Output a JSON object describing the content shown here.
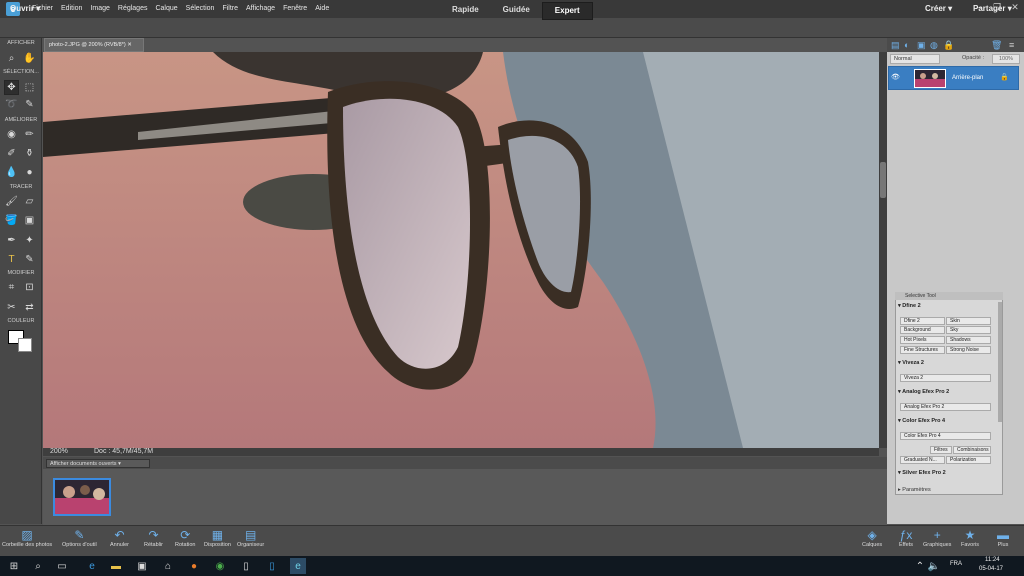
{
  "menu": {
    "items": [
      "Fichier",
      "Edition",
      "Image",
      "Réglages",
      "Calque",
      "Sélection",
      "Filtre",
      "Affichage",
      "Fenêtre",
      "Aide"
    ]
  },
  "modebar": {
    "open_label": "Ouvrir",
    "modes": [
      "Rapide",
      "Guidée",
      "Expert"
    ],
    "active_mode": "Expert",
    "create_label": "Créer",
    "share_label": "Partager"
  },
  "tools": {
    "sections": [
      "AFFICHER",
      "SÉLECTION...",
      "AMÉLIORER",
      "TRACER",
      "MODIFIER",
      "COULEUR"
    ]
  },
  "document": {
    "tab_title": "photo-2.JPG @ 200% (RVB/8*)",
    "zoom": "200%",
    "doc_info": "Doc : 45,7M/45,7M"
  },
  "photobin": {
    "select_value": "Afficher documents ouverts"
  },
  "layers": {
    "blend_mode": "Normal",
    "opacity_label": "Opacité :",
    "opacity_value": "100%",
    "layer_name": "Arrière-plan"
  },
  "selective_tool": {
    "title": "Selective Tool",
    "sections": [
      {
        "name": "Dfine 2",
        "buttons": [
          "Dfine 2",
          "Skin",
          "Background",
          "Sky",
          "Hot Pixels",
          "Shadows",
          "Fine Structures",
          "Strong Noise"
        ]
      },
      {
        "name": "Viveza 2",
        "buttons": [
          "Viveza 2"
        ]
      },
      {
        "name": "Analog Efex Pro 2",
        "buttons": [
          "Analog Efex Pro 2"
        ]
      },
      {
        "name": "Color Efex Pro 4",
        "buttons": [
          "Color Efex Pro 4",
          "Filtres",
          "Combinaisons",
          "Graduated N...",
          "Polarization"
        ]
      },
      {
        "name": "Silver Efex Pro 2",
        "buttons": []
      }
    ],
    "params_label": "Paramètres"
  },
  "bottombar": {
    "left": [
      "Corbeille des photos",
      "Options d'outil",
      "Annuler",
      "Rétablir",
      "Rotation",
      "Disposition",
      "Organiseur"
    ],
    "right": [
      "Calques",
      "Effets",
      "Graphiques",
      "Favoris",
      "Plus"
    ]
  },
  "taskbar": {
    "lang": "FRA",
    "time": "11:24",
    "date": "05-04-17"
  },
  "colors": {
    "accent": "#3a7ec2",
    "panel_dark": "#4b4b4b",
    "panel_light": "#c8c8c8"
  }
}
